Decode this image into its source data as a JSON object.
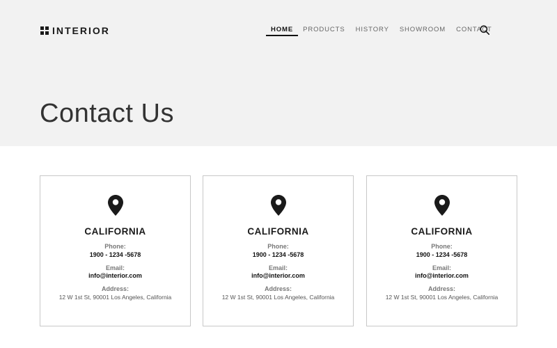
{
  "brand": {
    "name": "INTERIOR"
  },
  "nav": {
    "items": [
      {
        "label": "HOME",
        "active": true
      },
      {
        "label": "PRODUCTS",
        "active": false
      },
      {
        "label": "HISTORY",
        "active": false
      },
      {
        "label": "SHOWROOM",
        "active": false
      },
      {
        "label": "CONTACT",
        "active": false
      }
    ],
    "search_icon": "search-icon"
  },
  "page": {
    "title": "Contact Us"
  },
  "locations": [
    {
      "icon": "map-pin-icon",
      "region": "CALIFORNIA",
      "phone_label": "Phone:",
      "phone": "1900 - 1234 -5678",
      "email_label": "Email:",
      "email": "info@interior.com",
      "address_label": "Address:",
      "address": "12 W 1st St, 90001 Los Angeles, California"
    },
    {
      "icon": "map-pin-icon",
      "region": "CALIFORNIA",
      "phone_label": "Phone:",
      "phone": "1900 - 1234 -5678",
      "email_label": "Email:",
      "email": "info@interior.com",
      "address_label": "Address:",
      "address": "12 W 1st St, 90001 Los Angeles, California"
    },
    {
      "icon": "map-pin-icon",
      "region": "CALIFORNIA",
      "phone_label": "Phone:",
      "phone": "1900 - 1234 -5678",
      "email_label": "Email:",
      "email": "info@interior.com",
      "address_label": "Address:",
      "address": "12 W 1st St, 90001 Los Angeles, California"
    }
  ],
  "colors": {
    "hero_bg": "#f2f2f2",
    "text_dark": "#1a1a1a",
    "card_border": "#c8c8c8"
  }
}
